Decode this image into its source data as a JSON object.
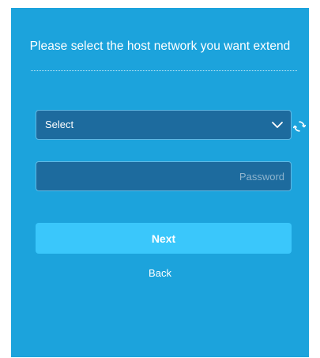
{
  "header": {
    "title": "Please select the host network you want extend"
  },
  "network_select": {
    "selected": "Select",
    "chevron_icon": "chevron-down-icon",
    "refresh_icon": "refresh-icon"
  },
  "password": {
    "placeholder": "Password",
    "value": ""
  },
  "actions": {
    "next_label": "Next",
    "back_label": "Back"
  },
  "colors": {
    "background": "#1ca3dc",
    "field": "#1d6b9e",
    "button": "#3ac7fb",
    "text": "#ffffff"
  }
}
